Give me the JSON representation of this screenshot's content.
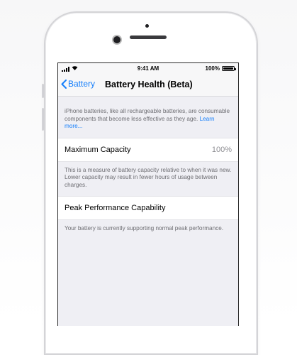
{
  "status_bar": {
    "time": "9:41 AM",
    "battery_percent": "100%",
    "battery_level": 1.0,
    "signal_icon": "cellular-signal-icon",
    "wifi_icon": "wifi-icon"
  },
  "nav": {
    "back_label": "Battery",
    "back_icon": "chevron-left-icon",
    "title": "Battery Health (Beta)"
  },
  "intro": {
    "text": "iPhone batteries, like all rechargeable batteries, are consumable components that become less effective as they age.",
    "link": "Learn more..."
  },
  "maximum_capacity": {
    "label": "Maximum Capacity",
    "value": "100%",
    "description": "This is a measure of battery capacity relative to when it was new. Lower capacity may result in fewer hours of usage between charges."
  },
  "peak_performance": {
    "label": "Peak Performance Capability",
    "description": "Your battery is currently supporting normal peak performance."
  },
  "colors": {
    "accent": "#147efb",
    "background": "#efeff4",
    "secondary_text": "#6d6d72"
  }
}
